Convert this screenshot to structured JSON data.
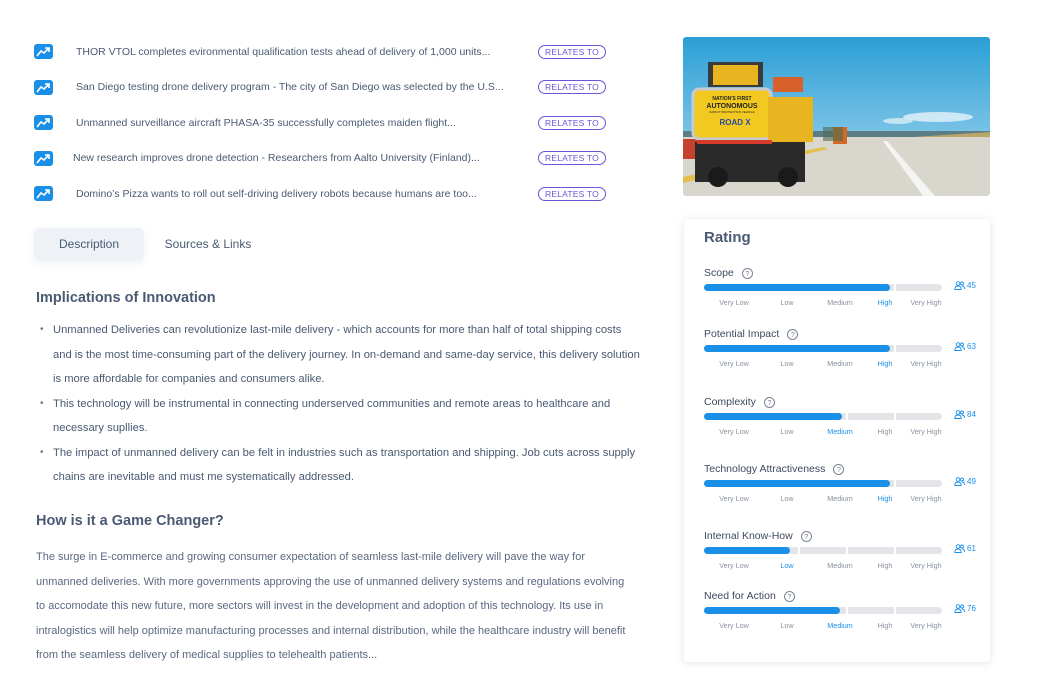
{
  "news": [
    {
      "title": "THOR VTOL completes evironmental qualification tests ahead of delivery of 1,000 units...",
      "badge": "RELATES TO",
      "icon": "trending-up-icon"
    },
    {
      "title": "San Diego testing drone delivery program - The city of San Diego was selected by the U.S...",
      "badge": "RELATES TO",
      "icon": "trending-up-icon"
    },
    {
      "title": "Unmanned surveillance aircraft PHASA-35 successfully completes maiden flight...",
      "badge": "RELATES TO",
      "icon": "trending-up-icon"
    },
    {
      "title": "New research improves drone detection - Researchers from Aalto University (Finland)...",
      "badge": "RELATES TO",
      "icon": "trending-up-icon"
    },
    {
      "title": "Domino’s Pizza wants to roll out self-driving delivery robots because humans are too...",
      "badge": "RELATES TO",
      "icon": "trending-up-icon"
    }
  ],
  "tabs": [
    {
      "label": "Description",
      "active": true
    },
    {
      "label": "Sources & Links",
      "active": false
    }
  ],
  "implications": {
    "title": "Implications of Innovation",
    "bullets": [
      "Unmanned Deliveries can revolutionize last-mile delivery - which accounts for more than half of total shipping costs and is the most time-consuming part of the delivery journey. In on-demand and same-day service, this delivery solution is more affordable for companies and consumers alike.",
      "This technology will be instrumental in connecting underserved communities and remote areas to healthcare and necessary supllies.",
      "The impact of unmanned delivery  can be felt in industries such as transportation and shipping. Job cuts across supply chains are inevitable and must me systematically addressed."
    ]
  },
  "game_changer": {
    "title": "How is it a Game Changer?",
    "text": "The surge in E-commerce and growing consumer expectation of seamless last-mile delivery will pave the way for unmanned deliveries. With more governments approving the use of unmanned delivery systems and regulations evolving to accomodate this new future, more sectors will invest in the development and adoption of this technology. Its use in intralogistics will help optimize manufacturing processes and internal distribution, while the healthcare industry will benefit from the seamless delivery of medical supplies to telehealth patients..."
  },
  "image": {
    "alt": "Autonomous impact protection truck on highway",
    "sign_lines": [
      "NATION'S FIRST",
      "AUTONOMOUS",
      "IMPACT PROTECTION VEHICLE",
      "ROAD X"
    ]
  },
  "rating": {
    "title": "Rating",
    "scale": [
      "Very Low",
      "Low",
      "Medium",
      "High",
      "Very High"
    ],
    "accent": "#1a8fe8",
    "items": [
      {
        "label": "Scope",
        "level": "High",
        "level_index": 3,
        "fill_fraction": 0.78,
        "votes": "45"
      },
      {
        "label": "Potential Impact",
        "level": "High",
        "level_index": 3,
        "fill_fraction": 0.78,
        "votes": "63"
      },
      {
        "label": "Complexity",
        "level": "Medium",
        "level_index": 2,
        "fill_fraction": 0.58,
        "votes": "84"
      },
      {
        "label": "Technology Attractiveness",
        "level": "High",
        "level_index": 3,
        "fill_fraction": 0.78,
        "votes": "49"
      },
      {
        "label": "Internal Know-How",
        "level": "Low",
        "level_index": 1,
        "fill_fraction": 0.36,
        "votes": "61"
      },
      {
        "label": "Need for Action",
        "level": "Medium",
        "level_index": 2,
        "fill_fraction": 0.57,
        "votes": "76"
      }
    ]
  }
}
